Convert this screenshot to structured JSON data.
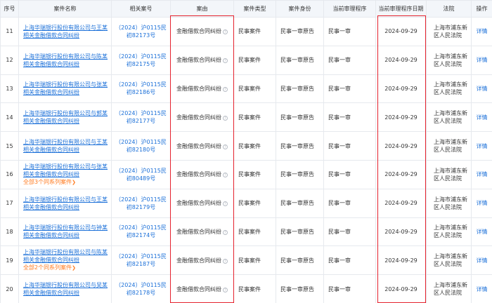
{
  "columns": {
    "seq": "序号",
    "name": "案件名称",
    "number": "相关案号",
    "cause": "案由",
    "type": "案件类型",
    "role": "案件身份",
    "procedure": "当前审理程序",
    "date": "当前审理程序日期",
    "court": "法院",
    "action": "操作"
  },
  "rows": [
    {
      "seq": "11",
      "name": "上海华瑞银行股份有限公司与王某相关金融借款合同纠纷",
      "more": "",
      "number": "（2024）沪0115民初82173号",
      "cause": "金融借款合同纠纷",
      "type": "民事案件",
      "role": "民事一审原告",
      "procedure": "民事一审",
      "date": "2024-09-29",
      "court": "上海市浦东新区人民法院",
      "action": "详情"
    },
    {
      "seq": "12",
      "name": "上海华瑞银行股份有限公司与陈某相关金融借款合同纠纷",
      "more": "",
      "number": "（2024）沪0115民初82175号",
      "cause": "金融借款合同纠纷",
      "type": "民事案件",
      "role": "民事一审原告",
      "procedure": "民事一审",
      "date": "2024-09-29",
      "court": "上海市浦东新区人民法院",
      "action": "详情"
    },
    {
      "seq": "13",
      "name": "上海华瑞银行股份有限公司与张某相关金融借款合同纠纷",
      "more": "",
      "number": "（2024）沪0115民初82186号",
      "cause": "金融借款合同纠纷",
      "type": "民事案件",
      "role": "民事一审原告",
      "procedure": "民事一审",
      "date": "2024-09-29",
      "court": "上海市浦东新区人民法院",
      "action": "详情"
    },
    {
      "seq": "14",
      "name": "上海华瑞银行股份有限公司与郭某相关金融借款合同纠纷",
      "more": "",
      "number": "（2024）沪0115民初82177号",
      "cause": "金融借款合同纠纷",
      "type": "民事案件",
      "role": "民事一审原告",
      "procedure": "民事一审",
      "date": "2024-09-29",
      "court": "上海市浦东新区人民法院",
      "action": "详情"
    },
    {
      "seq": "15",
      "name": "上海华瑞银行股份有限公司与王某相关金融借款合同纠纷",
      "more": "",
      "number": "（2024）沪0115民初82180号",
      "cause": "金融借款合同纠纷",
      "type": "民事案件",
      "role": "民事一审原告",
      "procedure": "民事一审",
      "date": "2024-09-29",
      "court": "上海市浦东新区人民法院",
      "action": "详情"
    },
    {
      "seq": "16",
      "name": "上海华瑞银行股份有限公司与张某相关金融借款合同纠纷",
      "more": "全部3个同系列案件",
      "number": "（2024）沪0115民初80489号",
      "cause": "金融借款合同纠纷",
      "type": "民事案件",
      "role": "民事一审原告",
      "procedure": "民事一审",
      "date": "2024-09-29",
      "court": "上海市浦东新区人民法院",
      "action": "详情"
    },
    {
      "seq": "17",
      "name": "上海华瑞银行股份有限公司与王某相关金融借款合同纠纷",
      "more": "",
      "number": "（2024）沪0115民初82179号",
      "cause": "金融借款合同纠纷",
      "type": "民事案件",
      "role": "民事一审原告",
      "procedure": "民事一审",
      "date": "2024-09-29",
      "court": "上海市浦东新区人民法院",
      "action": "详情"
    },
    {
      "seq": "18",
      "name": "上海华瑞银行股份有限公司与钟某相关金融借款合同纠纷",
      "more": "",
      "number": "（2024）沪0115民初82174号",
      "cause": "金融借款合同纠纷",
      "type": "民事案件",
      "role": "民事一审原告",
      "procedure": "民事一审",
      "date": "2024-09-29",
      "court": "上海市浦东新区人民法院",
      "action": "详情"
    },
    {
      "seq": "19",
      "name": "上海华瑞银行股份有限公司与陈某相关金融借款合同纠纷",
      "more": "全部2个同系列案件",
      "number": "（2024）沪0115民初82187号",
      "cause": "金融借款合同纠纷",
      "type": "民事案件",
      "role": "民事一审原告",
      "procedure": "民事一审",
      "date": "2024-09-29",
      "court": "上海市浦东新区人民法院",
      "action": "详情"
    },
    {
      "seq": "20",
      "name": "上海华瑞银行股份有限公司与吴某相关金融借款合同纠纷",
      "more": "",
      "number": "（2024）沪0115民初82178号",
      "cause": "金融借款合同纠纷",
      "type": "民事案件",
      "role": "民事一审原告",
      "procedure": "民事一审",
      "date": "2024-09-29",
      "court": "上海市浦东新区人民法院",
      "action": "详情"
    }
  ],
  "icons": {
    "help": "question-circle-icon",
    "more": "chevron-right-icon"
  },
  "colors": {
    "link": "#1a6fd8",
    "more_link": "#ff7a1f",
    "header_bg": "#f3f6fa",
    "highlight": "#e5222e"
  }
}
